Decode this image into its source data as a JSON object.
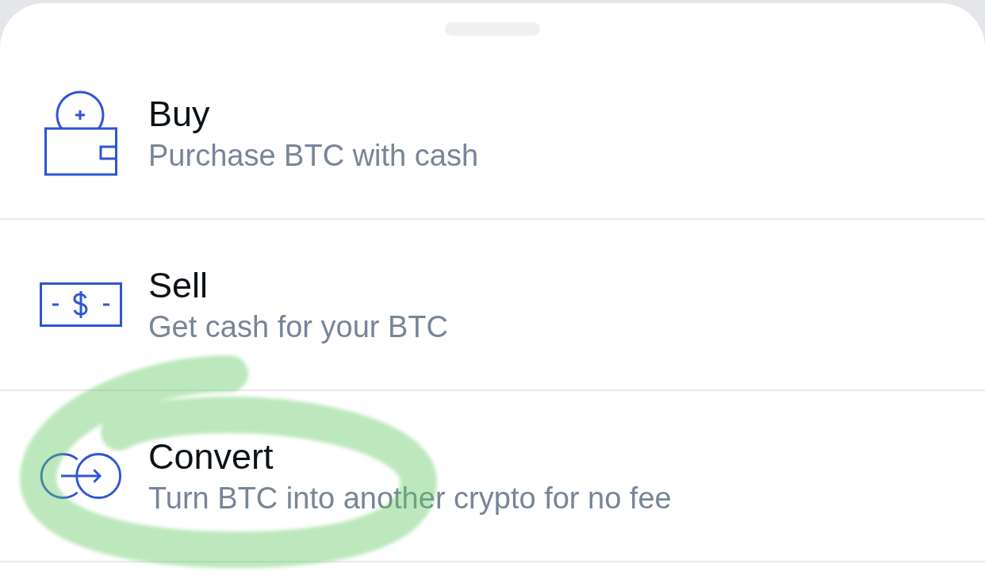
{
  "rows": [
    {
      "kind": "buy",
      "title": "Buy",
      "subtitle": "Purchase BTC with cash",
      "highlighted": false
    },
    {
      "kind": "sell",
      "title": "Sell",
      "subtitle": "Get cash for your BTC",
      "highlighted": false
    },
    {
      "kind": "convert",
      "title": "Convert",
      "subtitle": "Turn BTC into another crypto for no fee",
      "highlighted": true
    }
  ]
}
